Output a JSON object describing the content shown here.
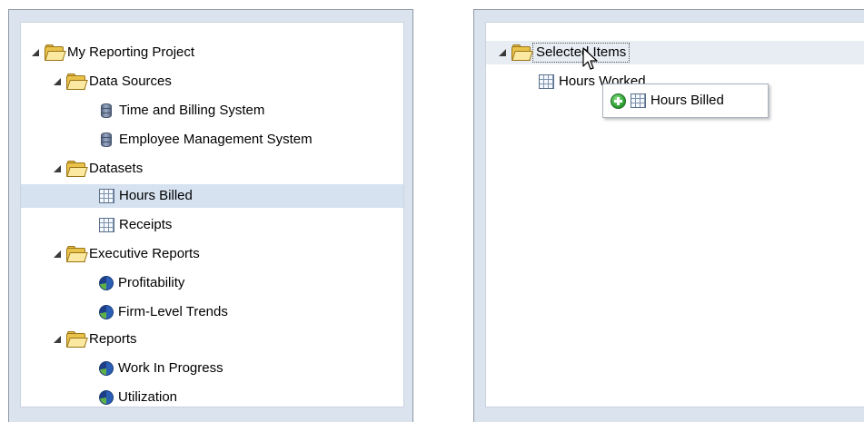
{
  "left_tree": {
    "root": {
      "label": "My Reporting Project",
      "icon": "folder-icon",
      "expanded": true
    },
    "data_sources": {
      "label": "Data Sources",
      "icon": "folder-icon",
      "expanded": true,
      "items": [
        {
          "label": "Time and Billing System",
          "icon": "database-icon"
        },
        {
          "label": "Employee Management System",
          "icon": "database-icon"
        }
      ]
    },
    "datasets": {
      "label": "Datasets",
      "icon": "folder-icon",
      "expanded": true,
      "items": [
        {
          "label": "Hours Billed",
          "icon": "grid-icon",
          "selected": true
        },
        {
          "label": "Receipts",
          "icon": "grid-icon"
        }
      ]
    },
    "executive_reports": {
      "label": "Executive Reports",
      "icon": "folder-icon",
      "expanded": true,
      "items": [
        {
          "label": "Profitability",
          "icon": "report-icon"
        },
        {
          "label": "Firm-Level Trends",
          "icon": "report-icon"
        }
      ]
    },
    "reports": {
      "label": "Reports",
      "icon": "folder-icon",
      "expanded": true,
      "items": [
        {
          "label": "Work In Progress",
          "icon": "report-icon"
        },
        {
          "label": "Utilization",
          "icon": "report-icon"
        }
      ]
    }
  },
  "right_tree": {
    "root": {
      "label": "Selected Items",
      "icon": "folder-icon",
      "expanded": true,
      "focused": true
    },
    "items": [
      {
        "label": "Hours Worked",
        "icon": "grid-icon"
      }
    ]
  },
  "drag_popup": {
    "label": "Hours Billed",
    "icons": [
      "add-icon",
      "grid-icon"
    ]
  },
  "colors": {
    "pane_background": "#dbe3ee",
    "selected_row": "#d6e2f0",
    "folder_fill": "#e9c24c"
  }
}
